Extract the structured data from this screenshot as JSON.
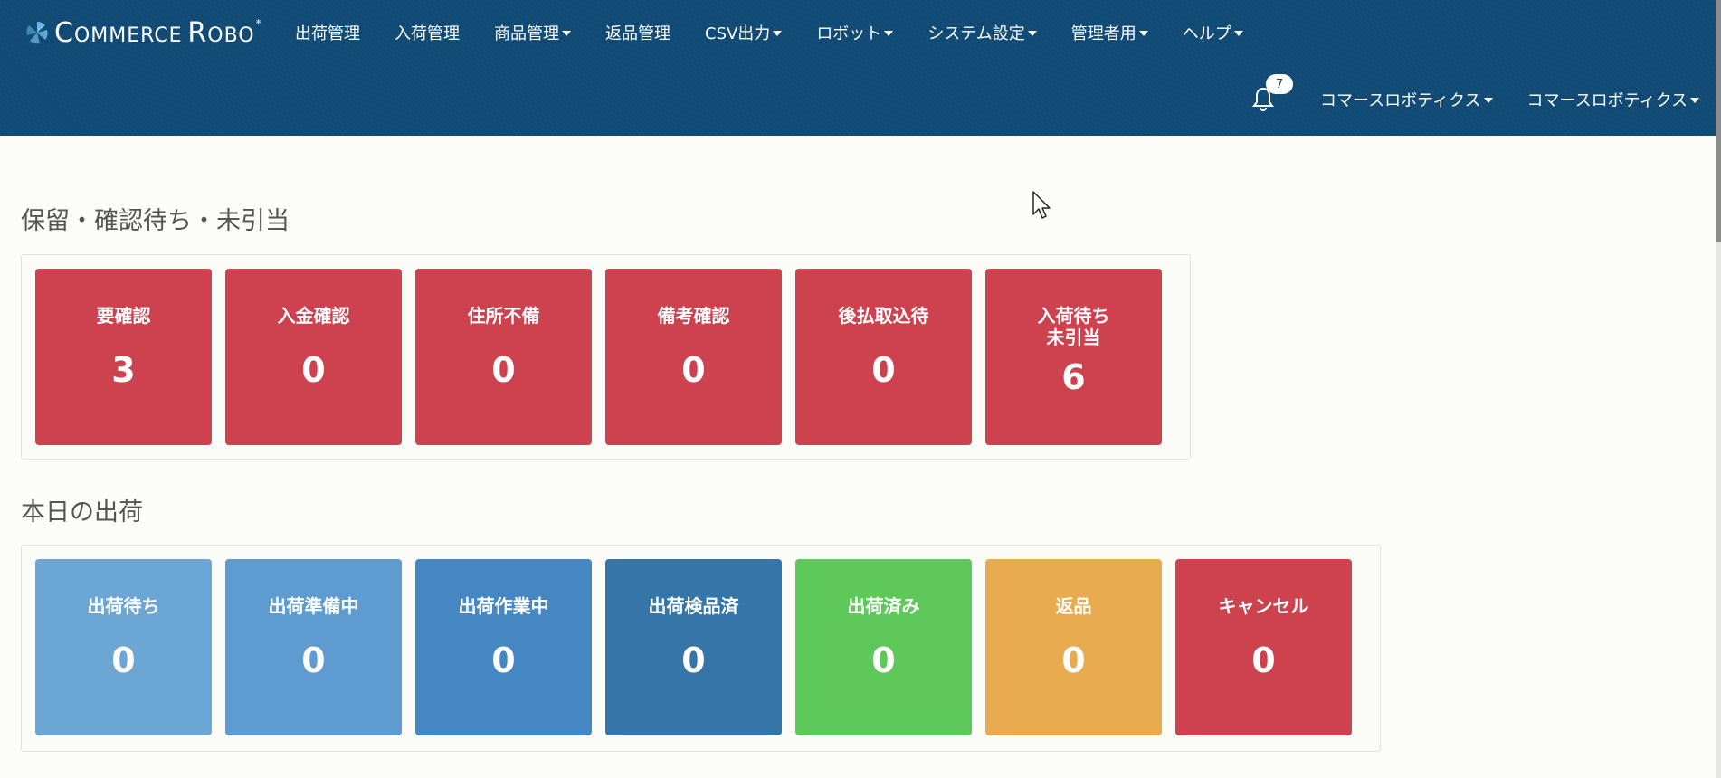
{
  "brand": {
    "name_first": "C",
    "name_rest": "OMMERCE",
    "name_first2": "R",
    "name_rest2": "OBO",
    "mark": "*"
  },
  "nav": {
    "items": [
      {
        "label": "出荷管理",
        "dropdown": false
      },
      {
        "label": "入荷管理",
        "dropdown": false
      },
      {
        "label": "商品管理",
        "dropdown": true
      },
      {
        "label": "返品管理",
        "dropdown": false
      },
      {
        "label": "CSV出力",
        "dropdown": true
      },
      {
        "label": "ロボット",
        "dropdown": true
      },
      {
        "label": "システム設定",
        "dropdown": true
      },
      {
        "label": "管理者用",
        "dropdown": true
      },
      {
        "label": "ヘルプ",
        "dropdown": true
      }
    ],
    "notifications_count": "7",
    "user_menus": [
      "コマースロボティクス",
      "コマースロボティクス"
    ]
  },
  "sections": {
    "hold": {
      "title": "保留・確認待ち・未引当",
      "tiles": [
        {
          "label": "要確認",
          "count": "3",
          "color": "#cd424e"
        },
        {
          "label": "入金確認",
          "count": "0",
          "color": "#cd424e"
        },
        {
          "label": "住所不備",
          "count": "0",
          "color": "#cd424e"
        },
        {
          "label": "備考確認",
          "count": "0",
          "color": "#cd424e"
        },
        {
          "label": "後払取込待",
          "count": "0",
          "color": "#cd424e"
        },
        {
          "label": "入荷待ち\n未引当",
          "count": "6",
          "color": "#cd424e"
        }
      ]
    },
    "today": {
      "title": "本日の出荷",
      "tiles": [
        {
          "label": "出荷待ち",
          "count": "0",
          "color": "#6ca6d5"
        },
        {
          "label": "出荷準備中",
          "count": "0",
          "color": "#5d9bd0"
        },
        {
          "label": "出荷作業中",
          "count": "0",
          "color": "#4487c3"
        },
        {
          "label": "出荷検品済",
          "count": "0",
          "color": "#3575a8"
        },
        {
          "label": "出荷済み",
          "count": "0",
          "color": "#5fc85b"
        },
        {
          "label": "返品",
          "count": "0",
          "color": "#e8ab4f"
        },
        {
          "label": "キャンセル",
          "count": "0",
          "color": "#cd424e"
        }
      ]
    }
  },
  "icons": {
    "bell": "bell-icon",
    "caret": "caret-down-icon",
    "logo": "logo-mark-icon",
    "cursor": "mouse-pointer-icon"
  }
}
